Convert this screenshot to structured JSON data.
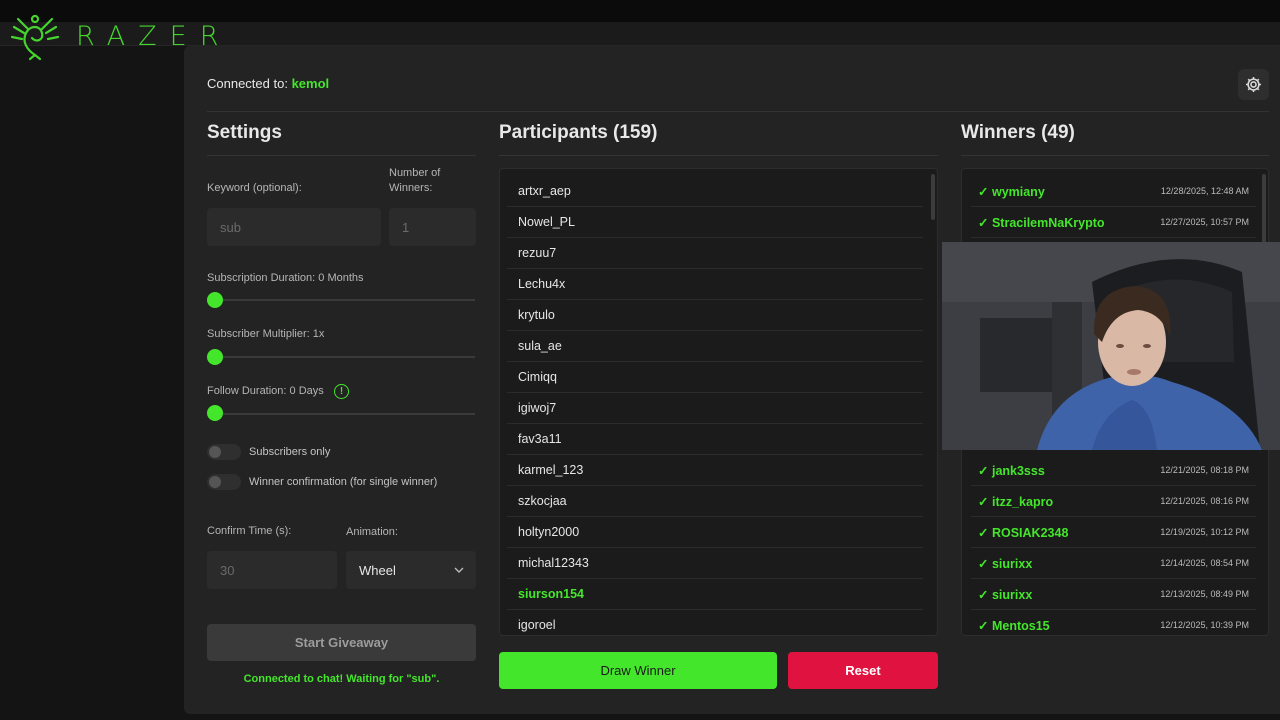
{
  "brand": {
    "name": "RAZER",
    "color": "#44d62c"
  },
  "header": {
    "connected_prefix": "Connected to:",
    "channel": "kemol"
  },
  "settings": {
    "title": "Settings",
    "keyword_label": "Keyword (optional):",
    "keyword_value": "sub",
    "winners_label": "Number of Winners:",
    "winners_value": "1",
    "sub_duration_label": "Subscription Duration: 0 Months",
    "sub_duration_value": 0,
    "multiplier_label": "Subscriber Multiplier: 1x",
    "multiplier_value": 1,
    "follow_label": "Follow Duration: 0 Days",
    "follow_value": 0,
    "info_glyph": "!",
    "subs_only_label": "Subscribers only",
    "subs_only_on": false,
    "confirm_label": "Winner confirmation (for single winner)",
    "confirm_on": false,
    "confirm_time_label": "Confirm Time (s):",
    "confirm_time_value": "30",
    "animation_label": "Animation:",
    "animation_value": "Wheel",
    "start_label": "Start Giveaway",
    "status": "Connected to chat! Waiting for \"sub\"."
  },
  "participants": {
    "title": "Participants (159)",
    "items": [
      {
        "name": "artxr_aep"
      },
      {
        "name": "Nowel_PL"
      },
      {
        "name": "rezuu7"
      },
      {
        "name": "Lechu4x"
      },
      {
        "name": "krytulo"
      },
      {
        "name": "sula_ae"
      },
      {
        "name": "Cimiqq"
      },
      {
        "name": "igiwoj7"
      },
      {
        "name": "fav3a11"
      },
      {
        "name": "karmel_123"
      },
      {
        "name": "szkocjaa"
      },
      {
        "name": "holtyn2000"
      },
      {
        "name": "michal12343"
      },
      {
        "name": "siurson154",
        "highlight": true
      },
      {
        "name": "igoroel"
      }
    ],
    "draw_label": "Draw Winner",
    "reset_label": "Reset"
  },
  "winners": {
    "title": "Winners (49)",
    "check": "✓",
    "items": [
      {
        "name": "wymiany",
        "date": "12/28/2025, 12:48 AM"
      },
      {
        "name": "StracilemNaKrypto",
        "date": "12/27/2025, 10:57 PM"
      },
      {
        "name": "jank3sss",
        "date": "12/21/2025, 08:18 PM",
        "row": 9
      },
      {
        "name": "itzz_kapro",
        "date": "12/21/2025, 08:16 PM",
        "row": 10
      },
      {
        "name": "ROSIAK2348",
        "date": "12/19/2025, 10:12 PM",
        "row": 11
      },
      {
        "name": "siurixx",
        "date": "12/14/2025, 08:54 PM",
        "row": 12
      },
      {
        "name": "siurixx",
        "date": "12/13/2025, 08:49 PM",
        "row": 13
      },
      {
        "name": "Mentos15",
        "date": "12/12/2025, 10:39 PM",
        "row": 14
      }
    ]
  },
  "colors": {
    "accent": "#44e62c",
    "danger": "#e0123f",
    "panel": "#232323"
  }
}
